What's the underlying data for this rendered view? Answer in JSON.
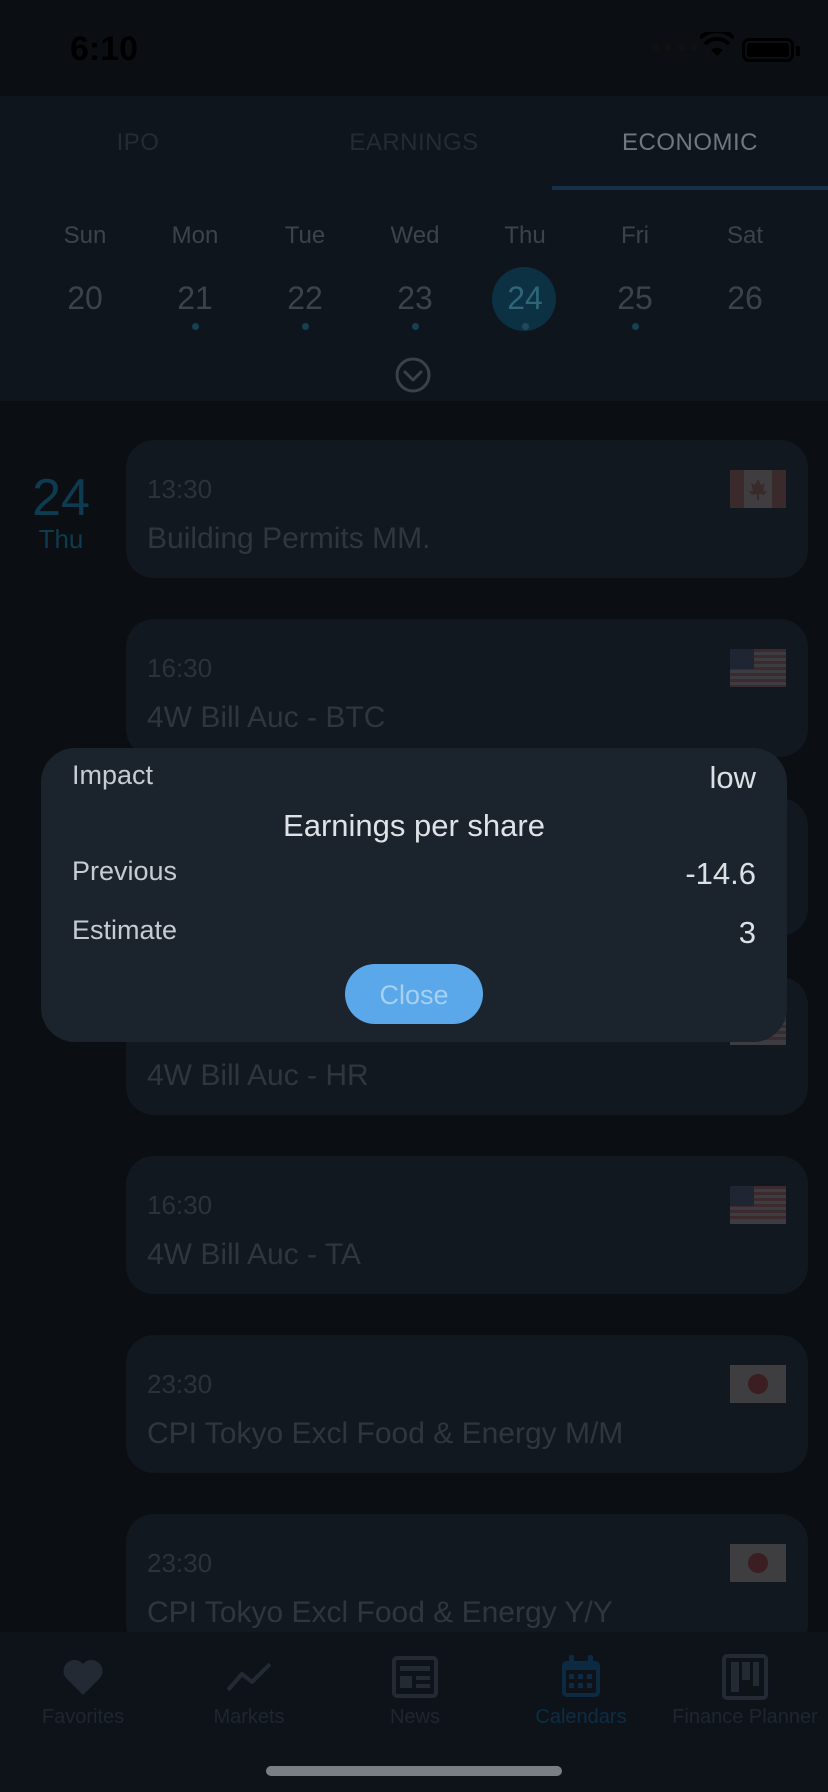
{
  "status_bar": {
    "time": "6:10"
  },
  "top_tabs": [
    {
      "label": "IPO",
      "active": false
    },
    {
      "label": "EARNINGS",
      "active": false
    },
    {
      "label": "ECONOMIC",
      "active": true
    }
  ],
  "calendar": {
    "weekdays": [
      "Sun",
      "Mon",
      "Tue",
      "Wed",
      "Thu",
      "Fri",
      "Sat"
    ],
    "days": [
      {
        "num": "20",
        "dot": false,
        "selected": false
      },
      {
        "num": "21",
        "dot": true,
        "selected": false
      },
      {
        "num": "22",
        "dot": true,
        "selected": false
      },
      {
        "num": "23",
        "dot": true,
        "selected": false
      },
      {
        "num": "24",
        "dot": true,
        "selected": true
      },
      {
        "num": "25",
        "dot": true,
        "selected": false
      },
      {
        "num": "26",
        "dot": false,
        "selected": false
      }
    ]
  },
  "date_label": {
    "day": "24",
    "weekday": "Thu"
  },
  "events": [
    {
      "time": "13:30",
      "title": "Building Permits MM.",
      "flag": "canada-flag"
    },
    {
      "time": "16:30",
      "title": "4W Bill Auc - BTC",
      "flag": "us-flag"
    },
    {
      "time": "",
      "title": "",
      "flag": "us-flag"
    },
    {
      "time": "",
      "title": "4W Bill Auc - HR",
      "flag": "us-flag"
    },
    {
      "time": "16:30",
      "title": "4W Bill Auc - TA",
      "flag": "us-flag"
    },
    {
      "time": "23:30",
      "title": "CPI Tokyo  Excl Food & Energy M/M",
      "flag": "japan-flag"
    },
    {
      "time": "23:30",
      "title": "CPI Tokyo  Excl Food & Energy Y/Y",
      "flag": "japan-flag"
    }
  ],
  "modal": {
    "impact_label": "Impact",
    "impact_value": "low",
    "title": "Earnings per share",
    "previous_label": "Previous",
    "previous_value": "-14.6",
    "estimate_label": "Estimate",
    "estimate_value": "3",
    "close_label": "Close"
  },
  "tabbar": [
    {
      "label": "Favorites",
      "icon": "heart-icon",
      "active": false
    },
    {
      "label": "Markets",
      "icon": "trend-line-icon",
      "active": false
    },
    {
      "label": "News",
      "icon": "newspaper-icon",
      "active": false
    },
    {
      "label": "Calendars",
      "icon": "calendar-icon",
      "active": true
    },
    {
      "label": "Finance Planner",
      "icon": "kanban-board-icon",
      "active": false
    }
  ]
}
